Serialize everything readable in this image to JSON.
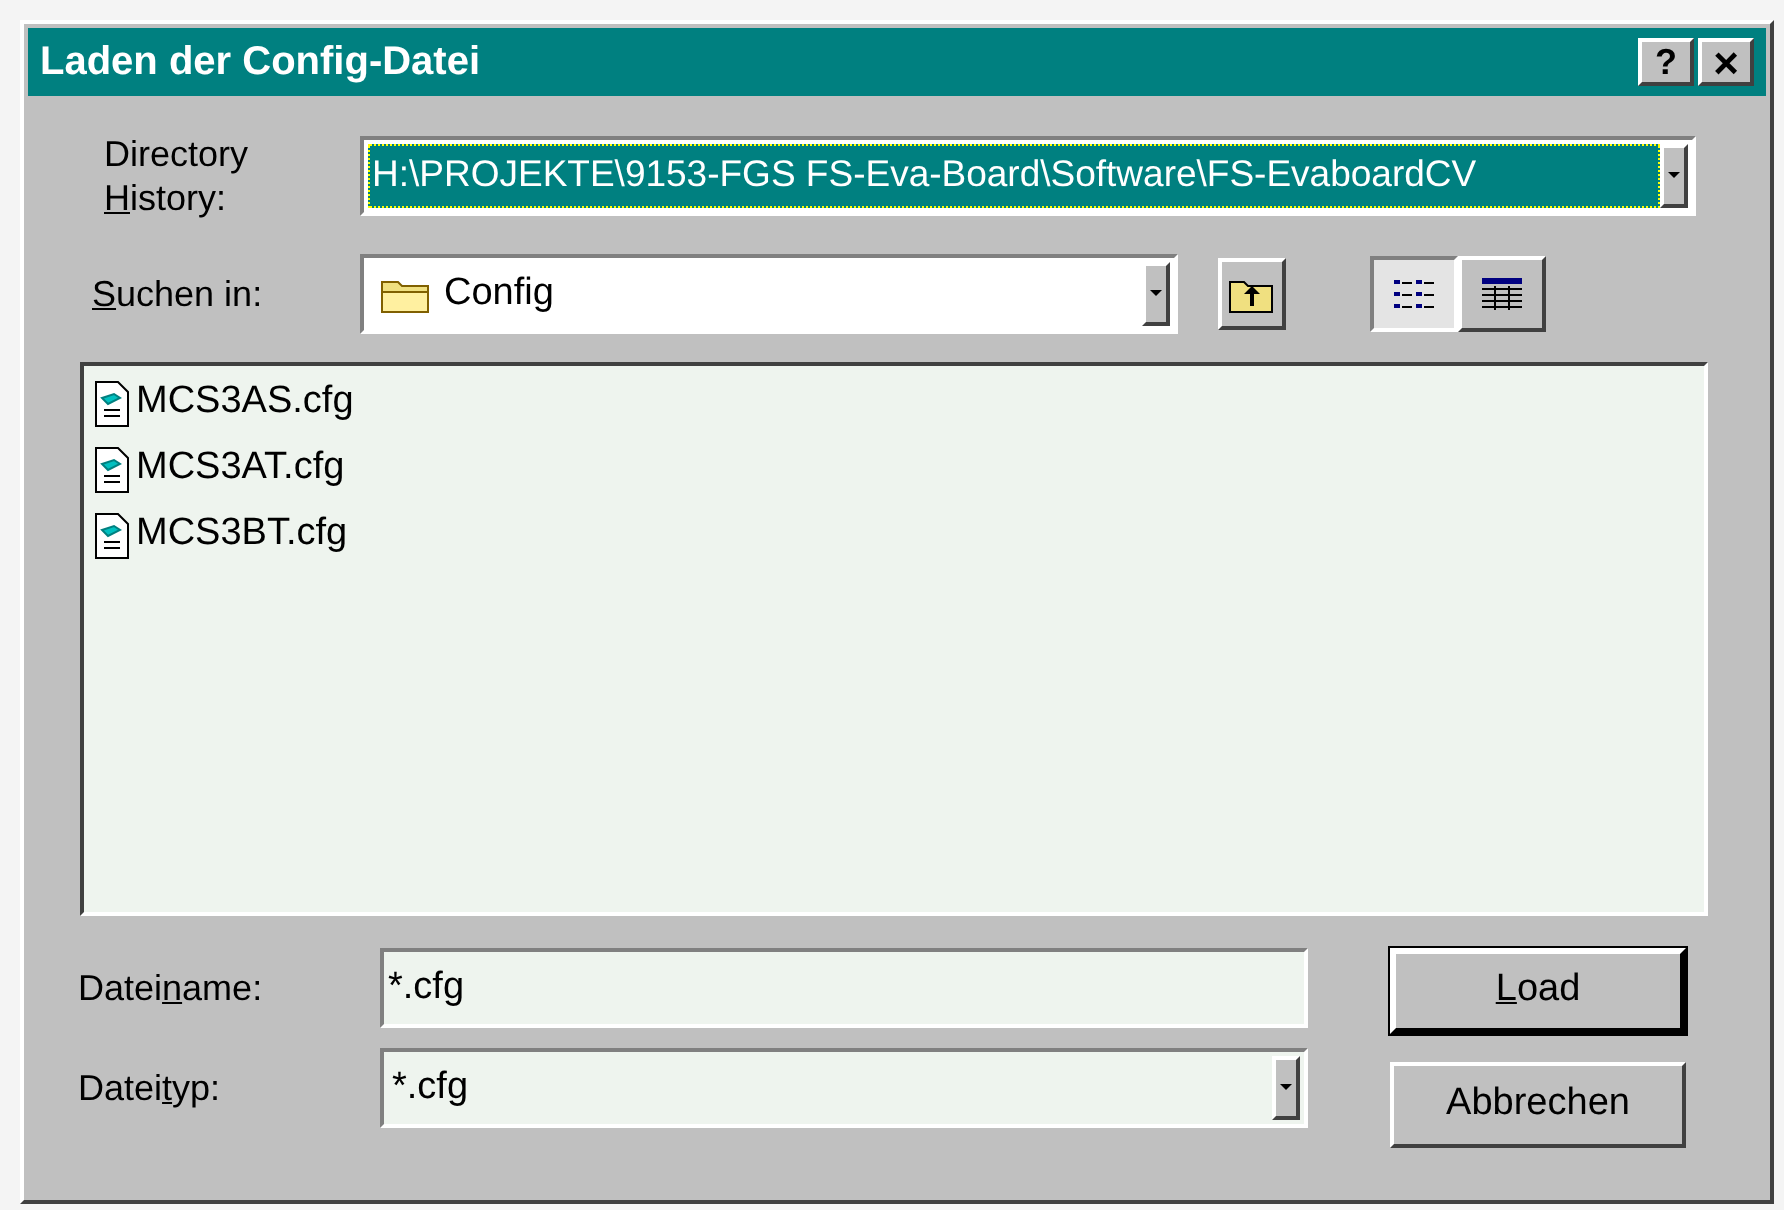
{
  "window": {
    "title": "Laden der Config-Datei",
    "help_button": "?",
    "close_button": "×"
  },
  "directory_history": {
    "label": {
      "before": "Directory ",
      "key": "H",
      "after": "istory:"
    },
    "value": "H:\\PROJEKTE\\9153-FGS FS-Eva-Board\\Software\\FS-EvaboardCV",
    "selected": true
  },
  "look_in": {
    "label": {
      "key": "S",
      "after": "uchen in:"
    },
    "value": "Config"
  },
  "view_buttons": [
    {
      "kind": "list",
      "selected": true
    },
    {
      "kind": "details",
      "selected": false
    }
  ],
  "files": [
    {
      "name": "MCS3AS.cfg"
    },
    {
      "name": "MCS3AT.cfg"
    },
    {
      "name": "MCS3BT.cfg"
    }
  ],
  "file_name": {
    "label": {
      "before": "Datei",
      "key": "n",
      "after": "ame:"
    },
    "value": "*.cfg"
  },
  "file_type": {
    "label": {
      "before": "Datei",
      "key": "t",
      "after": "yp:"
    },
    "value": "*.cfg"
  },
  "buttons": [
    {
      "label": {
        "key": "L",
        "after": "oad"
      },
      "default": true
    },
    {
      "label": {
        "before": "Abbrechen"
      },
      "default": false
    }
  ]
}
